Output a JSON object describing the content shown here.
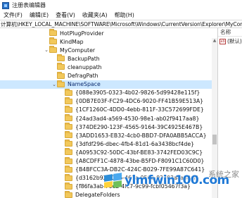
{
  "window": {
    "title": "注册表编辑器"
  },
  "menu": [
    "文件(F)",
    "编辑(E)",
    "查看(V)",
    "收藏夹(A)",
    "帮助(H)"
  ],
  "address": "计算机\\HKEY_LOCAL_MACHINE\\SOFTWARE\\Microsoft\\Windows\\CurrentVersion\\Explorer\\MyComputer\\NameSpace",
  "tree": [
    {
      "label": "HotPlugProvider",
      "indent": 2,
      "expand": ""
    },
    {
      "label": "KindMap",
      "indent": 2,
      "expand": ""
    },
    {
      "label": "MyComputer",
      "indent": 2,
      "expand": "v"
    },
    {
      "label": "BackupPath",
      "indent": 3,
      "expand": ""
    },
    {
      "label": "cleanuppath",
      "indent": 3,
      "expand": ""
    },
    {
      "label": "DefragPath",
      "indent": 3,
      "expand": ""
    },
    {
      "label": "NameSpace",
      "indent": 3,
      "expand": "v",
      "selected": true
    },
    {
      "label": "{088e3905-0323-4b02-9826-5d99428e115f}",
      "indent": 4,
      "expand": ""
    },
    {
      "label": "{0DB7E03F-FC29-4DC6-9020-FF41B59E513A}",
      "indent": 4,
      "expand": ""
    },
    {
      "label": "{1CF1260C-4DD0-4ebb-811F-33C572699FDE}",
      "indent": 4,
      "expand": ""
    },
    {
      "label": "{24ad3ad4-a569-4530-98e1-ab02f9417aa8}",
      "indent": 4,
      "expand": ""
    },
    {
      "label": "{374DE290-123F-4565-9164-39C4925E467B}",
      "indent": 4,
      "expand": ""
    },
    {
      "label": "{3ADD1653-EB32-4cb0-BBD7-DFA0ABB5ACCA}",
      "indent": 4,
      "expand": ""
    },
    {
      "label": "{3dfdf296-dbec-4fb4-81d1-6a3438bcf4de}",
      "indent": 4,
      "expand": ""
    },
    {
      "label": "{A0953C92-50DC-43bf-BE83-3742FED03C9C}",
      "indent": 4,
      "expand": ""
    },
    {
      "label": "{A8CDFF1C-4878-43be-B5FD-F8091C1C60D0}",
      "indent": 4,
      "expand": ""
    },
    {
      "label": "{B4BFCC3A-DB2C-424C-B029-7FE99A87C641}",
      "indent": 4,
      "expand": ""
    },
    {
      "label": "{d3162b92-9365-467a-956b-92703aca08af}",
      "indent": 4,
      "expand": ""
    },
    {
      "label": "{f86fa3ab-70d2-4fc7-9c99-fcbf05467f3a}",
      "indent": 4,
      "expand": ""
    },
    {
      "label": "DelegateFolders",
      "indent": 4,
      "expand": ""
    }
  ],
  "values": {
    "header": "名称",
    "items": [
      {
        "icon": "ab",
        "name": "(默认)"
      }
    ]
  },
  "watermark": {
    "text": "ylmfwin100.com",
    "cn": "系统之家"
  },
  "colors": {
    "selection": "#cde8ff",
    "folder": "#f2c85b",
    "watermark": "#1f79d6"
  }
}
